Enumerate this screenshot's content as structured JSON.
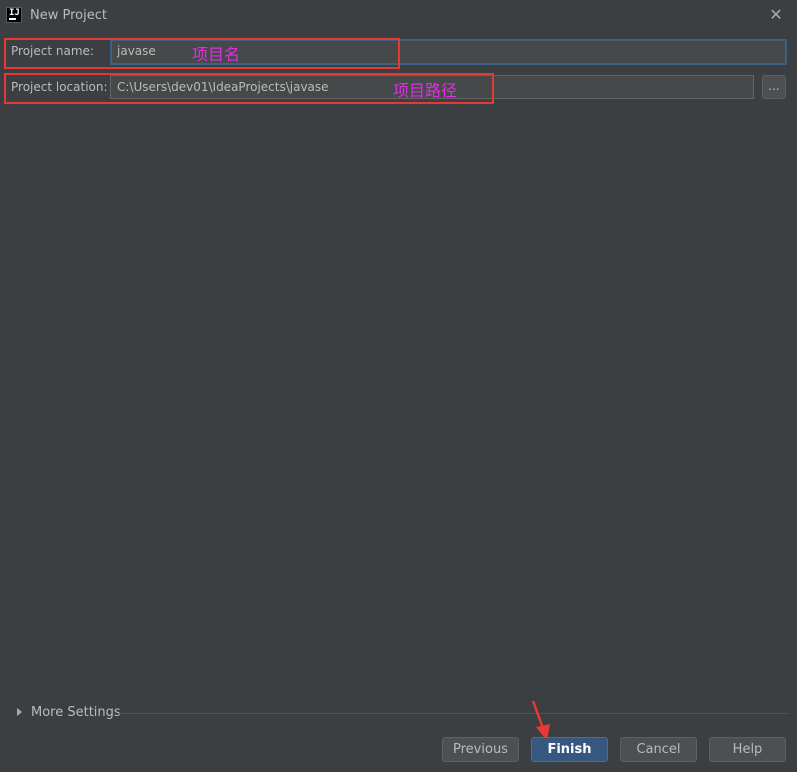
{
  "window": {
    "title": "New Project",
    "close_symbol": "✕",
    "icon": "intellij-idea-icon",
    "icon_text": "IJ"
  },
  "form": {
    "name_label": "Project name:",
    "name_value": "javase",
    "location_label": "Project location:",
    "location_value": "C:\\Users\\dev01\\IdeaProjects\\javase",
    "browse_label": "..."
  },
  "annotations": {
    "name_note": "项目名",
    "location_note": "项目路径",
    "color": "#e030e0",
    "box_color": "#e53935"
  },
  "more_settings": {
    "label": "More Settings"
  },
  "buttons": {
    "previous": "Previous",
    "finish": "Finish",
    "cancel": "Cancel",
    "help": "Help"
  },
  "colors": {
    "background": "#3c3f41",
    "input_bg": "#45494a",
    "focus_border": "#3d6185",
    "default_button": "#365880"
  }
}
